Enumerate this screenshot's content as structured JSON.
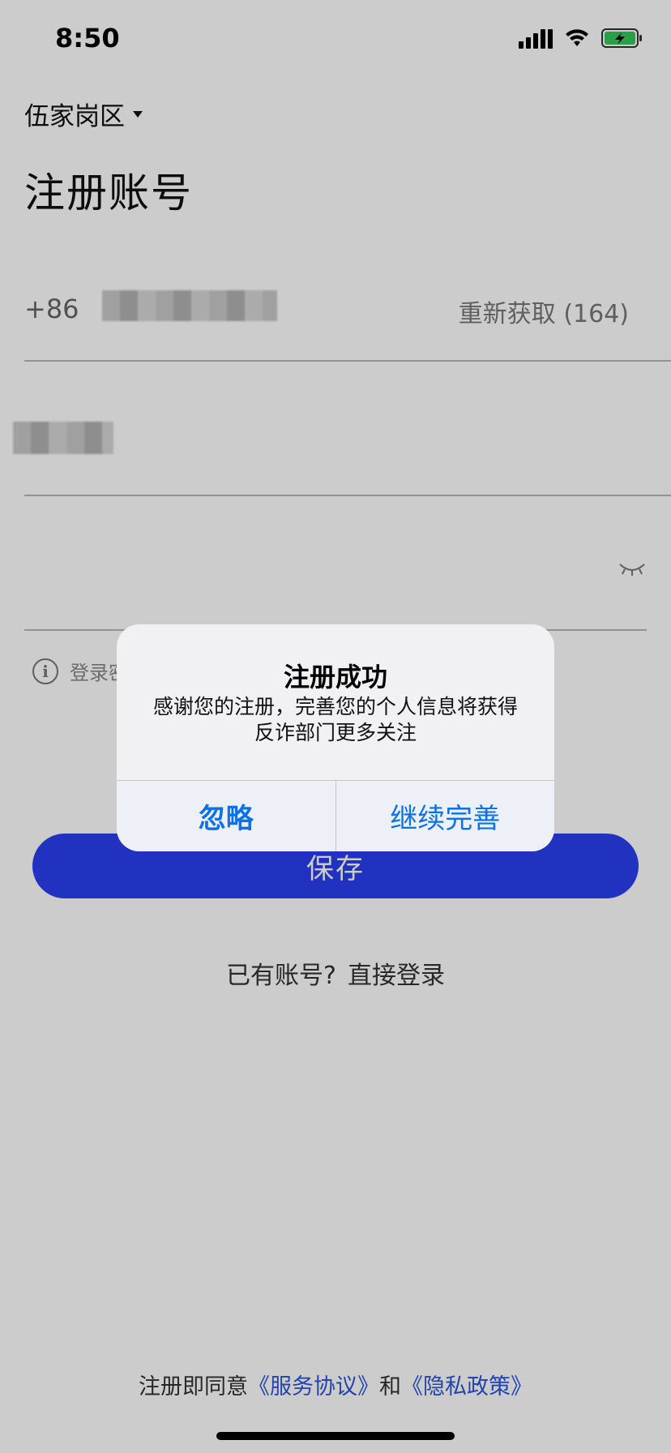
{
  "status_bar": {
    "time": "8:50",
    "icons": [
      "cellular-signal-icon",
      "wifi-icon",
      "battery-charging-icon"
    ],
    "battery_color": "#34c759"
  },
  "header": {
    "region": "伍家岗区",
    "title": "注册账号"
  },
  "form": {
    "phone": {
      "country_code": "+86",
      "resend_label": "重新获取 (164)"
    },
    "password": {
      "toggle_icon": "eye-closed-icon"
    },
    "hint_text": "登录密"
  },
  "save_button": "保存",
  "login_prompt": {
    "question": "已有账号?",
    "link": "直接登录"
  },
  "agreement": {
    "prefix": "注册即同意",
    "terms": "《服务协议》",
    "and": "和",
    "privacy": "《隐私政策》"
  },
  "alert": {
    "title": "注册成功",
    "message": "感谢您的注册，完善您的个人信息将获得反诈部门更多关注",
    "ignore": "忽略",
    "continue": "继续完善"
  },
  "colors": {
    "primary": "#2b3ff0",
    "link": "#2b55d8",
    "alert_button": "#0a72e6"
  }
}
